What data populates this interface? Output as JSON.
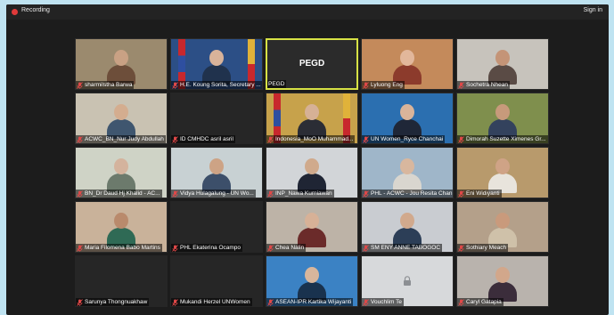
{
  "window": {
    "recording_label": "Recording",
    "signin_label": "Sign in"
  },
  "tiles": [
    {
      "name": "sharmilstha Barwa",
      "scene": "#9b8a6e",
      "shirt": "#6d4e3a",
      "skin": "#c9a184",
      "muted": true
    },
    {
      "name": "H.E. Koung Sorita, Secretary ...",
      "scene": "#2c4f86",
      "shirt": "#20324d",
      "skin": "#d8b39a",
      "muted": true,
      "flags": true
    },
    {
      "name": "PEGD",
      "scene": "#2b2b2b",
      "label": "PEGD",
      "muted": false,
      "active": true
    },
    {
      "name": "Lyluong Eng",
      "scene": "#c48a5b",
      "shirt": "#8c3b2c",
      "skin": "#e2b79b",
      "muted": true
    },
    {
      "name": "Sochetra Nhean",
      "scene": "#c7c3bc",
      "shirt": "#5a4b45",
      "skin": "#c49477",
      "muted": true
    },
    {
      "name": "ACWC_BN_Nur Judy Abdullah",
      "scene": "#c9c2b2",
      "shirt": "#3f566f",
      "skin": "#d4ad8f",
      "muted": true
    },
    {
      "name": "ID CMHDC asril asril",
      "scene": "#262626",
      "muted": true
    },
    {
      "name": "Indonesia_MoO Muhammad...",
      "scene": "#c7a24b",
      "shirt": "#2b2d35",
      "skin": "#d6b196",
      "muted": true,
      "flags": true
    },
    {
      "name": "UN Women_Ryce Chanchai",
      "scene": "#2b6fb0",
      "shirt": "#1f2738",
      "skin": "#d9b49a",
      "muted": true
    },
    {
      "name": "Dimorah Suzette Ximenes Gr...",
      "scene": "#7f8f4d",
      "shirt": "#33425d",
      "skin": "#c79a7b",
      "muted": true
    },
    {
      "name": "BN_Dr Daud Hj Khalid - AC...",
      "scene": "#cfd3c6",
      "shirt": "#6c7a6c",
      "skin": "#d4b39d",
      "muted": true
    },
    {
      "name": "Vidya Hulagalung - UN Wo...",
      "scene": "#c8d1d3",
      "shirt": "#3c4f6a",
      "skin": "#cda385",
      "muted": true
    },
    {
      "name": "INP_Nawa Kurniawan",
      "scene": "#d2d5d8",
      "shirt": "#1f2534",
      "skin": "#d0aa8c",
      "muted": true
    },
    {
      "name": "PHL - ACWC - Jou Resita Chan",
      "scene": "#9fb6c9",
      "shirt": "#d9d6cf",
      "skin": "#d8b79e",
      "muted": true
    },
    {
      "name": "Eni Widiyanti",
      "scene": "#b89a6c",
      "shirt": "#e8e4dc",
      "skin": "#cfa386",
      "muted": true
    },
    {
      "name": "Maria Filomena Babo Martins",
      "scene": "#c9b29a",
      "shirt": "#2f6a55",
      "skin": "#b98a6c",
      "muted": true
    },
    {
      "name": "PHL Ekaterina Ocampo",
      "scene": "#262626",
      "muted": true
    },
    {
      "name": "Chea Nalin",
      "scene": "#bdb3a7",
      "shirt": "#6b2b2a",
      "skin": "#d7b197",
      "muted": true
    },
    {
      "name": "SM ENY ANNE TABOGOC",
      "scene": "#c9ccd1",
      "shirt": "#2c3e57",
      "skin": "#d1a98d",
      "muted": true
    },
    {
      "name": "Sothiary Meach",
      "scene": "#b4a08a",
      "shirt": "#cfc1a9",
      "skin": "#c99a7c",
      "muted": true
    },
    {
      "name": "Sarunya Thongnuakhaw",
      "scene": "#262626",
      "muted": true
    },
    {
      "name": "Mukandi Herzel UNWomen",
      "scene": "#262626",
      "muted": true
    },
    {
      "name": "ASEAN-IPR Kartika Wijayanti",
      "scene": "#3b82c4",
      "shirt": "#19324e",
      "skin": "#d8b69c",
      "muted": true
    },
    {
      "name": "Vouchlim Te",
      "scene": "#d7d9db",
      "muted": true,
      "lock": true
    },
    {
      "name": "Caryl Gatapia",
      "scene": "#b9b3ad",
      "shirt": "#3b2d3b",
      "skin": "#d2a78b",
      "muted": true
    }
  ],
  "colors": {
    "background": "#bfe3f1",
    "frame": "#1c1c1c",
    "recording_dot": "#e03a3a",
    "active_speaker_border": "#d7e245",
    "muted_icon": "#e04848"
  }
}
